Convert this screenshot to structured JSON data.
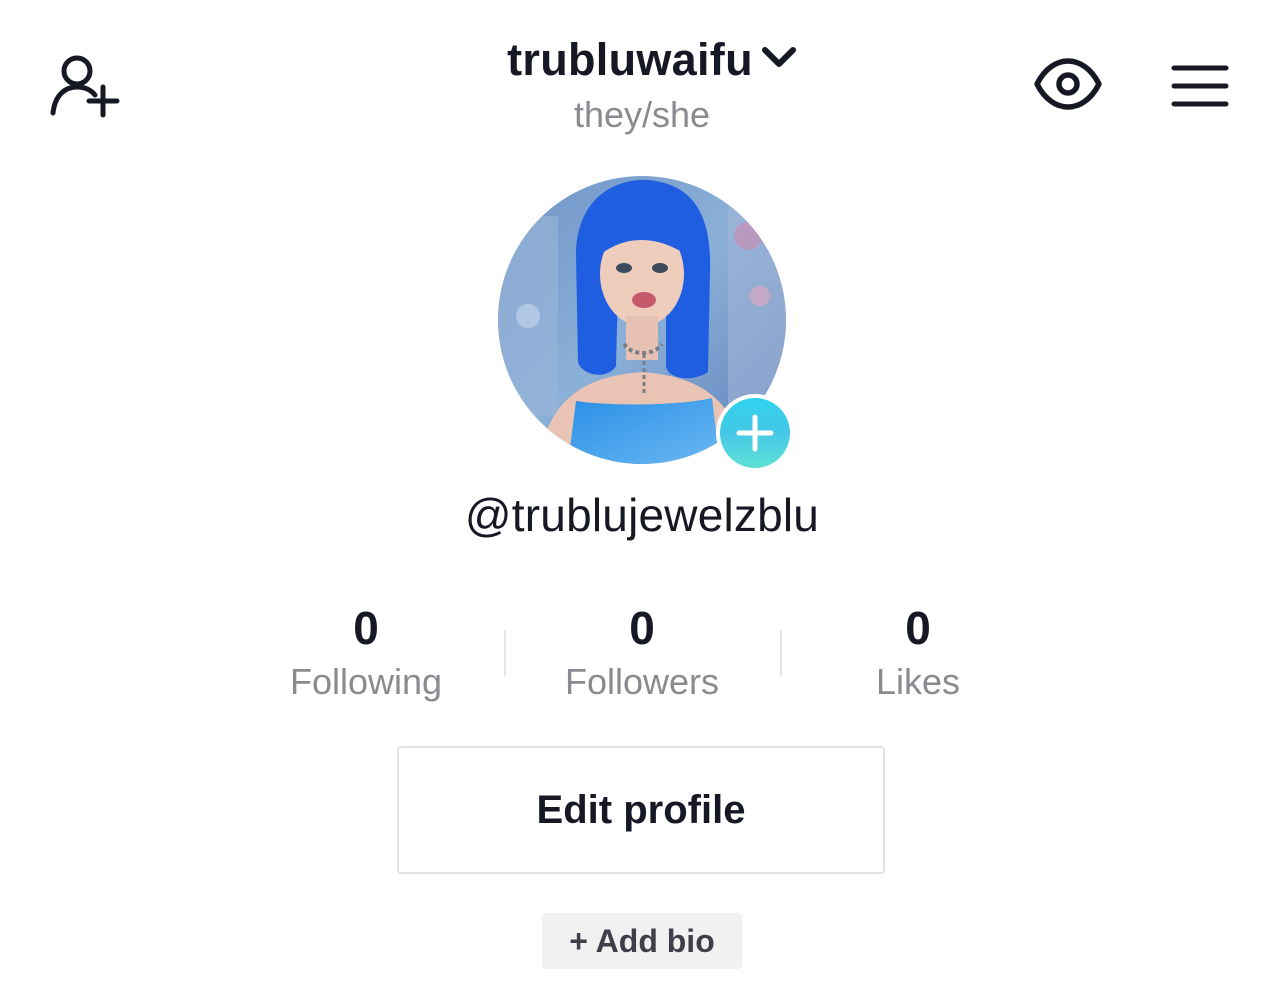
{
  "header": {
    "add_friend_icon": "add-friend-icon",
    "username": "trubluwaifu",
    "username_dropdown_icon": "chevron-down-icon",
    "pronouns": "they/she",
    "eye_icon": "eye-icon",
    "menu_icon": "menu-icon"
  },
  "profile": {
    "avatar_add_icon": "plus-icon",
    "handle": "@trublujewelzblu"
  },
  "stats": [
    {
      "value": "0",
      "label": "Following"
    },
    {
      "value": "0",
      "label": "Followers"
    },
    {
      "value": "0",
      "label": "Likes"
    }
  ],
  "actions": {
    "edit_profile": "Edit profile",
    "add_bio": "+ Add bio"
  },
  "colors": {
    "text_primary": "#161823",
    "text_secondary": "#8a8b91",
    "add_button_gradient_start": "#2fd2f0",
    "add_button_gradient_end": "#5fe0d4",
    "avatar_hair": "#1f5ee0"
  }
}
